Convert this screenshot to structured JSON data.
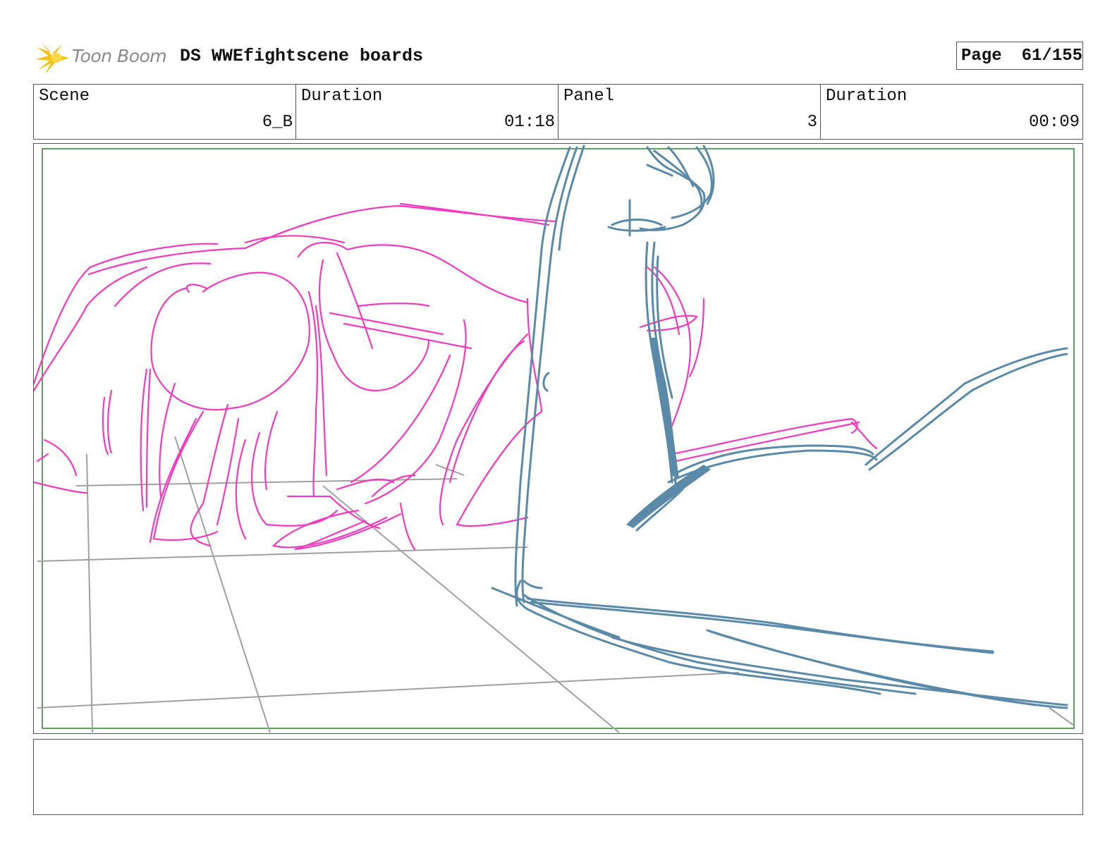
{
  "header": {
    "logo_text": "Toon Boom",
    "title": "DS WWEfightscene boards",
    "page_label": "Page",
    "page_value": "61/155"
  },
  "info": {
    "scene_label": "Scene",
    "scene_value": "6_B",
    "scene_duration_label": "Duration",
    "scene_duration_value": "01:18",
    "panel_label": "Panel",
    "panel_value": "3",
    "panel_duration_label": "Duration",
    "panel_duration_value": "00:09"
  },
  "sketch": {
    "colors": {
      "character_back": "#f03cbc",
      "character_front": "#5b8aa8",
      "floor_grid": "#a0a0a0",
      "safe_frame": "#2e7d32"
    }
  },
  "notes": {
    "text": ""
  }
}
